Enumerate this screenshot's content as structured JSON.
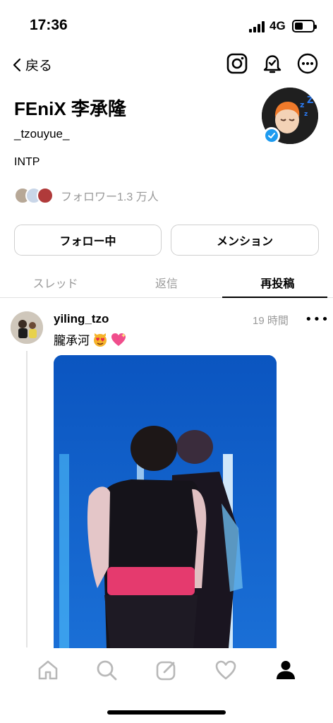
{
  "status_bar": {
    "time": "17:36",
    "network": "4G"
  },
  "nav": {
    "back_label": "戻る"
  },
  "profile": {
    "name": "FEniX 李承隆",
    "handle": "_tzouyue_",
    "bio": "INTP",
    "followers_text": "フォロワー1.3 万人",
    "verified": true
  },
  "buttons": {
    "following": "フォロー中",
    "mention": "メンション"
  },
  "tabs": [
    {
      "label": "スレッド",
      "active": false
    },
    {
      "label": "返信",
      "active": false
    },
    {
      "label": "再投稿",
      "active": true
    }
  ],
  "post": {
    "username": "yiling_tzo",
    "time": "19 時間",
    "text": "朧承河"
  },
  "icons": {
    "nav": [
      "instagram-icon",
      "notification-bell-icon",
      "more-options-icon"
    ],
    "tabbar": [
      "home-icon",
      "search-icon",
      "compose-icon",
      "heart-icon",
      "profile-icon"
    ]
  },
  "colors": {
    "verified": "#1d9bf0",
    "muted": "#999999",
    "media_bg": "#0f62c8"
  }
}
